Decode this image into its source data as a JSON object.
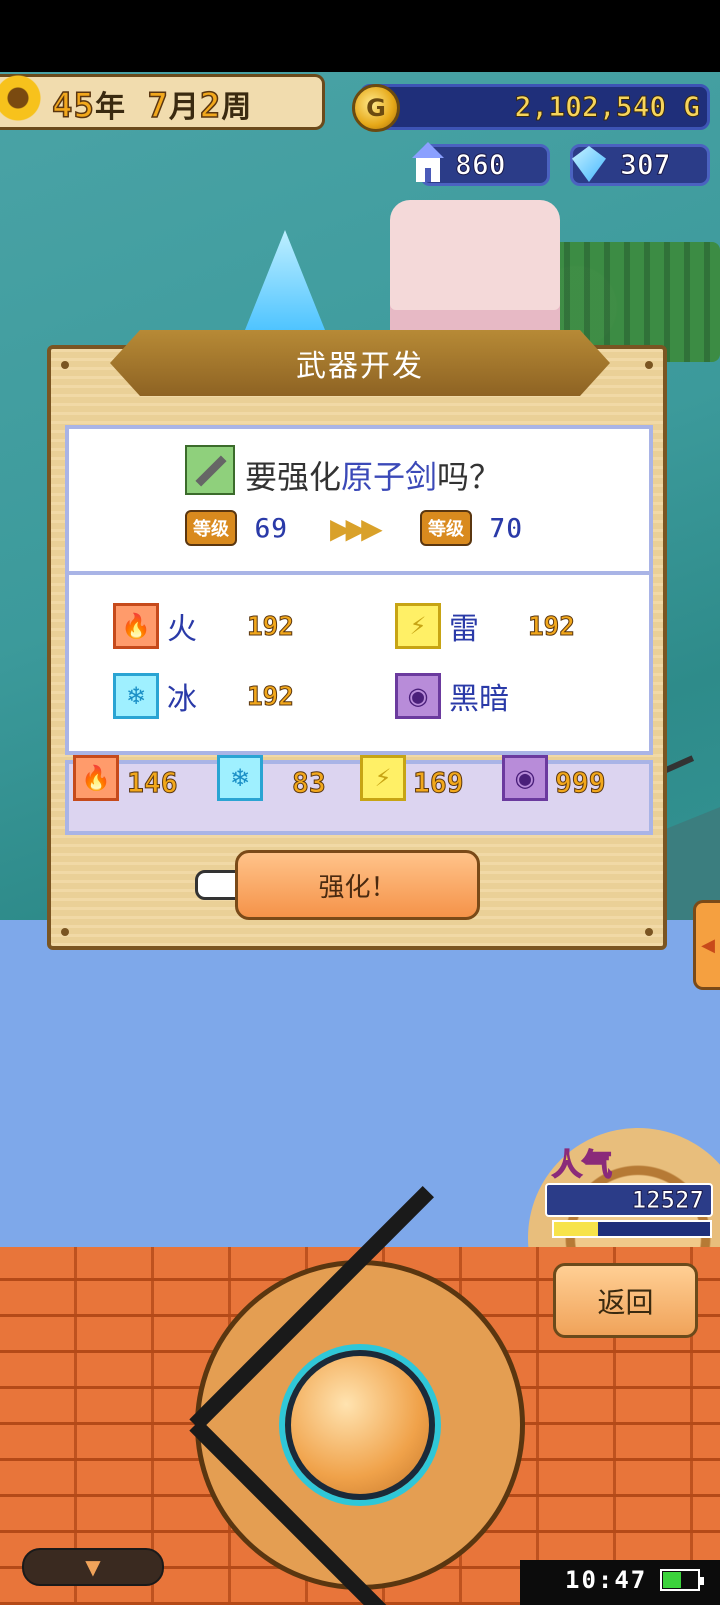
{
  "hud": {
    "date": {
      "year": "45",
      "year_unit": "年",
      "month": "7",
      "month_unit": "月",
      "week": "2",
      "week_unit": "周"
    },
    "gold": "2,102,540",
    "gold_unit": "G",
    "coin_symbol": "G",
    "population": "860",
    "gems": "307"
  },
  "dialog": {
    "title": "武器开发",
    "question_prefix": "要强化",
    "weapon_name": "原子剑",
    "question_suffix": "吗？",
    "level_label": "等级",
    "level_from": "69",
    "level_to": "70",
    "arrow": "▶▶▶",
    "elements": [
      {
        "name": "火",
        "value": "192",
        "icon": "fire-icon"
      },
      {
        "name": "雷",
        "value": "192",
        "icon": "thunder-icon"
      },
      {
        "name": "冰",
        "value": "192",
        "icon": "ice-icon"
      },
      {
        "name": "黑暗",
        "value": "",
        "icon": "dark-icon"
      }
    ],
    "resources": [
      {
        "icon": "fire-icon",
        "value": "146"
      },
      {
        "icon": "ice-icon",
        "value": "83"
      },
      {
        "icon": "thunder-icon",
        "value": "169"
      },
      {
        "icon": "dark-icon",
        "value": "999"
      }
    ],
    "enhance_button": "强化！"
  },
  "popularity": {
    "label": "人气",
    "value": "12527",
    "bar_fraction": 0.28
  },
  "controls": {
    "back_button": "返回",
    "down_arrow": "▼",
    "side_arrow": "◀"
  },
  "status": {
    "clock": "10:47",
    "battery_fraction": 0.55
  },
  "colors": {
    "accent": "#3b49b8",
    "gold_text": "#f2a81c",
    "panel_border": "#a9b4e6"
  }
}
